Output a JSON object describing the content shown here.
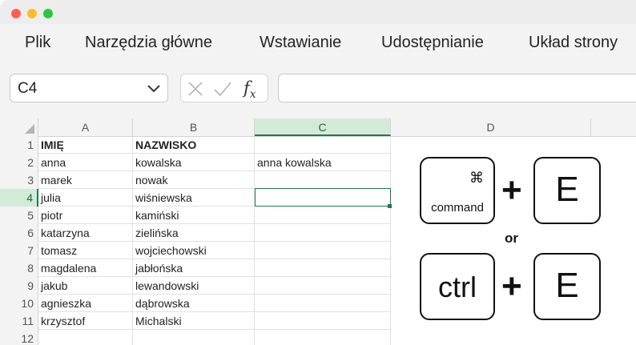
{
  "window": {
    "controls": [
      "close-icon",
      "minimize-icon",
      "zoom-icon"
    ]
  },
  "ribbon": {
    "tabs": [
      {
        "label": "Plik"
      },
      {
        "label": "Narzędzia główne"
      },
      {
        "label": "Wstawianie"
      },
      {
        "label": "Udostępnianie"
      },
      {
        "label": "Układ strony"
      }
    ]
  },
  "formula_bar": {
    "name_box": "C4",
    "fx_label": "f",
    "fx_sub": "x",
    "value": ""
  },
  "sheet": {
    "columns": [
      "A",
      "B",
      "C",
      "D"
    ],
    "active_column": "C",
    "active_row": "4",
    "row_numbers": [
      "1",
      "2",
      "3",
      "4",
      "5",
      "6",
      "7",
      "8",
      "9",
      "10",
      "11",
      "12"
    ],
    "rows": [
      {
        "a": "IMIĘ",
        "b": "NAZWISKO",
        "c": ""
      },
      {
        "a": "anna",
        "b": "kowalska",
        "c": "anna kowalska"
      },
      {
        "a": "marek",
        "b": "nowak",
        "c": ""
      },
      {
        "a": "julia",
        "b": "wiśniewska",
        "c": ""
      },
      {
        "a": "piotr",
        "b": "kamiński",
        "c": ""
      },
      {
        "a": "katarzyna",
        "b": "zielińska",
        "c": ""
      },
      {
        "a": "tomasz",
        "b": "wojciechowski",
        "c": ""
      },
      {
        "a": "magdalena",
        "b": "jabłońska",
        "c": ""
      },
      {
        "a": "jakub",
        "b": "lewandowski",
        "c": ""
      },
      {
        "a": "agnieszka",
        "b": "dąbrowska",
        "c": ""
      },
      {
        "a": "krzysztof",
        "b": "Michalski",
        "c": ""
      }
    ]
  },
  "shortcut": {
    "mac_key_symbol": "⌘",
    "mac_key_label": "command",
    "plus": "+",
    "letter": "E",
    "or": "or",
    "win_key_label": "ctrl"
  },
  "colors": {
    "accent": "#1e7b45",
    "active_header_bg": "#d3ead9"
  }
}
